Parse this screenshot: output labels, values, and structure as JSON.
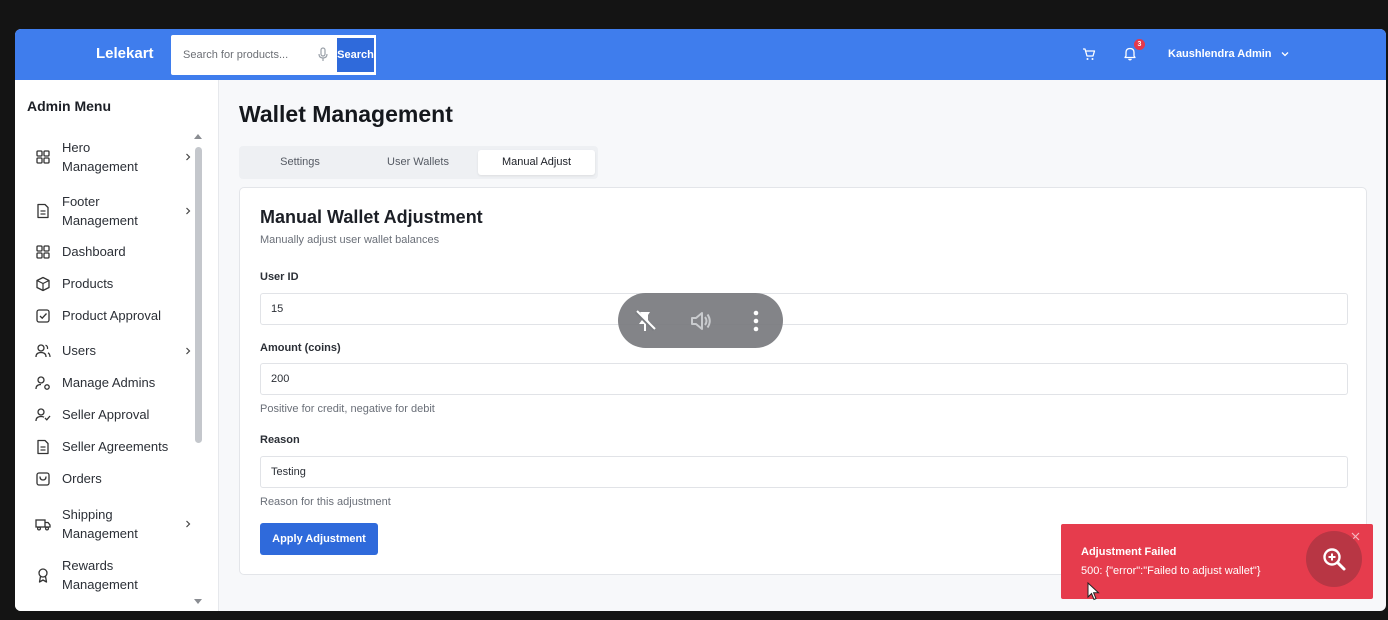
{
  "header": {
    "brand": "Lelekart",
    "search_placeholder": "Search for products...",
    "search_button": "Search",
    "notification_count": "3",
    "user_name": "Kaushlendra Admin",
    "accent_color": "#3f7ded",
    "icons": [
      "mic-icon",
      "cart-icon",
      "bell-icon",
      "chevron-down-icon"
    ]
  },
  "sidebar": {
    "title": "Admin Menu",
    "items": [
      {
        "label": "Hero Management",
        "icon": "grid-icon",
        "has_submenu": true
      },
      {
        "label": "Footer Management",
        "icon": "document-icon",
        "has_submenu": true
      },
      {
        "label": "Dashboard",
        "icon": "grid-icon",
        "has_submenu": false
      },
      {
        "label": "Products",
        "icon": "package-icon",
        "has_submenu": false
      },
      {
        "label": "Product Approval",
        "icon": "checkbox-icon",
        "has_submenu": false
      },
      {
        "label": "Users",
        "icon": "users-icon",
        "has_submenu": true
      },
      {
        "label": "Manage Admins",
        "icon": "user-key-icon",
        "has_submenu": false
      },
      {
        "label": "Seller Approval",
        "icon": "user-check-icon",
        "has_submenu": false
      },
      {
        "label": "Seller Agreements",
        "icon": "document-icon",
        "has_submenu": false
      },
      {
        "label": "Orders",
        "icon": "shopping-bag-icon",
        "has_submenu": false
      },
      {
        "label": "Shipping Management",
        "icon": "truck-icon",
        "has_submenu": true
      },
      {
        "label": "Rewards Management",
        "icon": "award-icon",
        "has_submenu": false
      }
    ]
  },
  "main": {
    "page_title": "Wallet Management",
    "tabs": [
      {
        "label": "Settings",
        "active": false
      },
      {
        "label": "User Wallets",
        "active": false
      },
      {
        "label": "Manual Adjust",
        "active": true
      }
    ],
    "card": {
      "title": "Manual Wallet Adjustment",
      "subtitle": "Manually adjust user wallet balances",
      "user_id_label": "User ID",
      "user_id_value": "15",
      "amount_label": "Amount (coins)",
      "amount_value": "200",
      "amount_hint": "Positive for credit, negative for debit",
      "reason_label": "Reason",
      "reason_value": "Testing",
      "reason_hint": "Reason for this adjustment",
      "apply_button": "Apply Adjustment"
    }
  },
  "media_overlay": {
    "icons": [
      "pin-off-icon",
      "volume-icon",
      "more-vertical-icon"
    ]
  },
  "toast": {
    "title": "Adjustment Failed",
    "message": "500: {\"error\":\"Failed to adjust wallet\"}",
    "color": "#e63c4d"
  }
}
